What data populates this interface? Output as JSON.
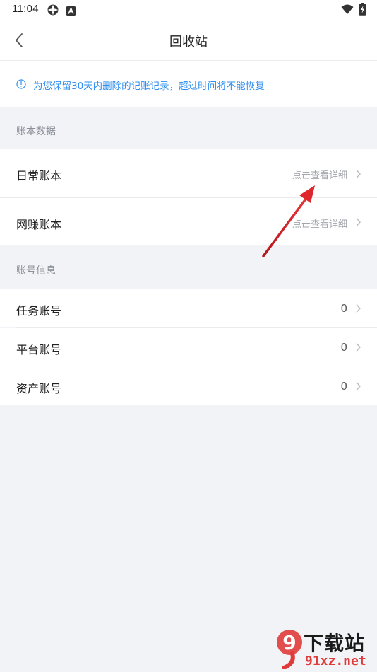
{
  "status_bar": {
    "time": "11:04",
    "icons": [
      "gear-icon",
      "a-box-icon",
      "wifi-icon",
      "battery-charging-icon"
    ]
  },
  "header": {
    "title": "回收站",
    "back_icon": "chevron-left-icon"
  },
  "notice": {
    "icon": "info-circle-icon",
    "text": "为您保留30天内删除的记账记录，超过时间将不能恢复",
    "color": "#2f8ef0"
  },
  "sections": {
    "books": {
      "title": "账本数据",
      "items": [
        {
          "label": "日常账本",
          "value": "点击查看详细"
        },
        {
          "label": "网赚账本",
          "value": "点击查看详细"
        }
      ]
    },
    "accounts": {
      "title": "账号信息",
      "items": [
        {
          "label": "任务账号",
          "value": "0"
        },
        {
          "label": "平台账号",
          "value": "0"
        },
        {
          "label": "资产账号",
          "value": "0"
        }
      ]
    }
  },
  "annotation": {
    "arrow_color": "#d9232a"
  },
  "watermark": {
    "logo_text": "9",
    "site_name": "下载站",
    "url": "91xz.net"
  }
}
